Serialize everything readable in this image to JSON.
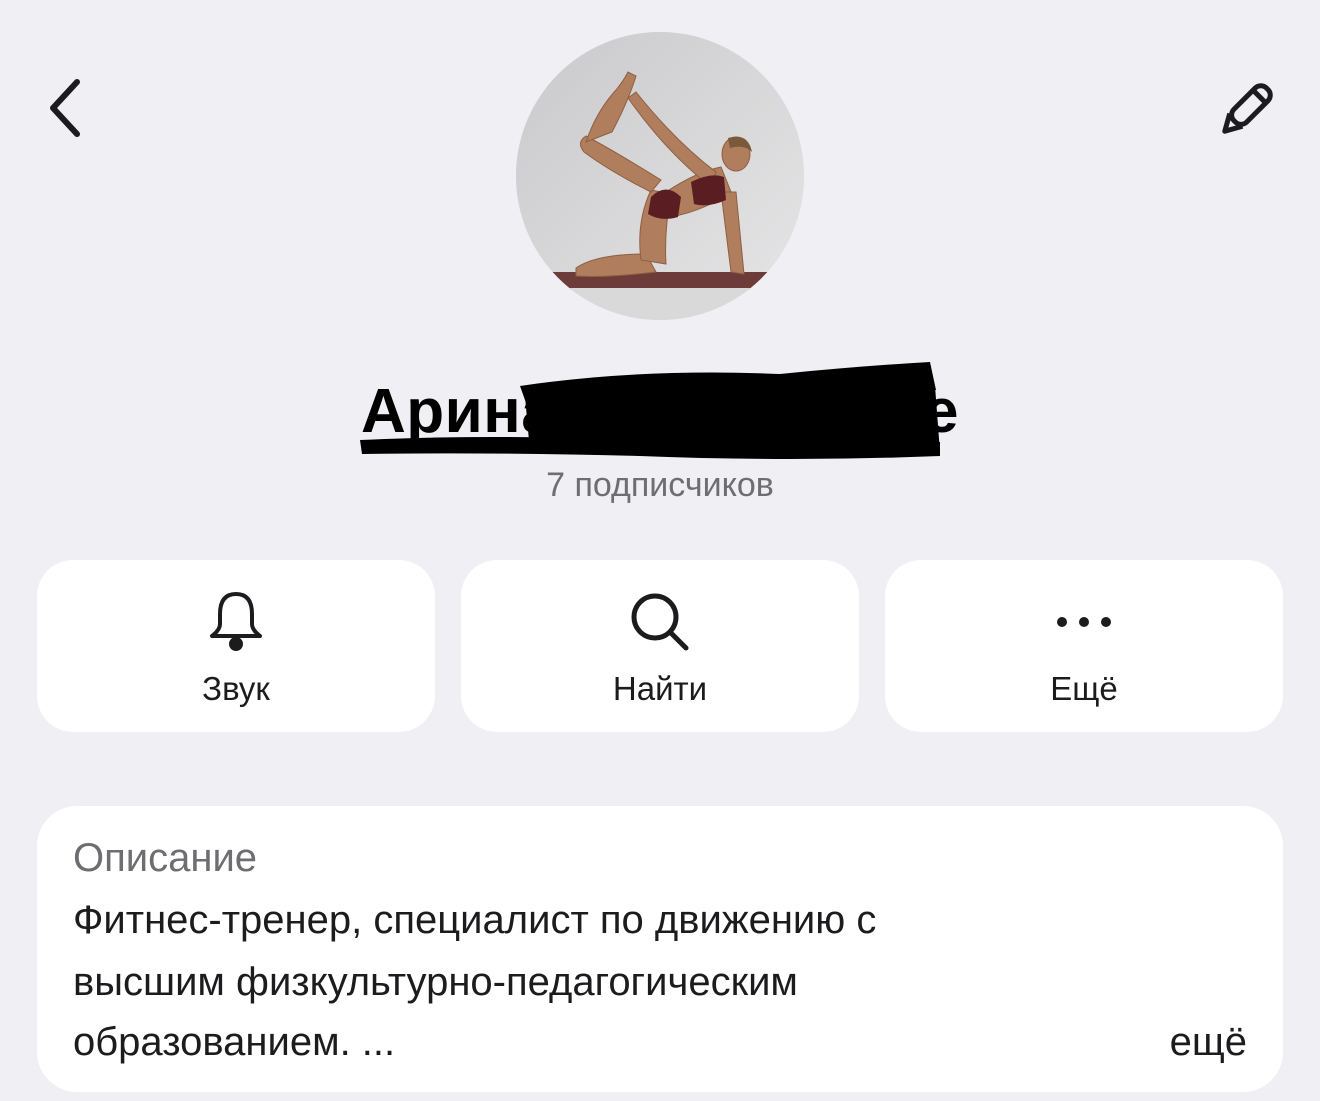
{
  "header": {
    "back_icon": "chevron-left-icon",
    "edit_icon": "pencil-icon"
  },
  "profile": {
    "avatar": "avatar-photo",
    "name": "Арина Fitness Love",
    "subscribers": "7 подписчиков"
  },
  "actions": [
    {
      "icon": "bell-icon",
      "label": "Звук"
    },
    {
      "icon": "search-icon",
      "label": "Найти"
    },
    {
      "icon": "more-dots-icon",
      "label": "Ещё"
    }
  ],
  "description": {
    "title": "Описание",
    "lines": [
      "Фитнес-тренер, специалист по движению с",
      "высшим физкультурно-педагогическим",
      "образованием. ..."
    ],
    "more_label": "ещё"
  },
  "colors": {
    "background": "#efeff4",
    "card": "#ffffff",
    "secondary_text": "#6d6d72",
    "primary_text": "#1c1c1e"
  }
}
